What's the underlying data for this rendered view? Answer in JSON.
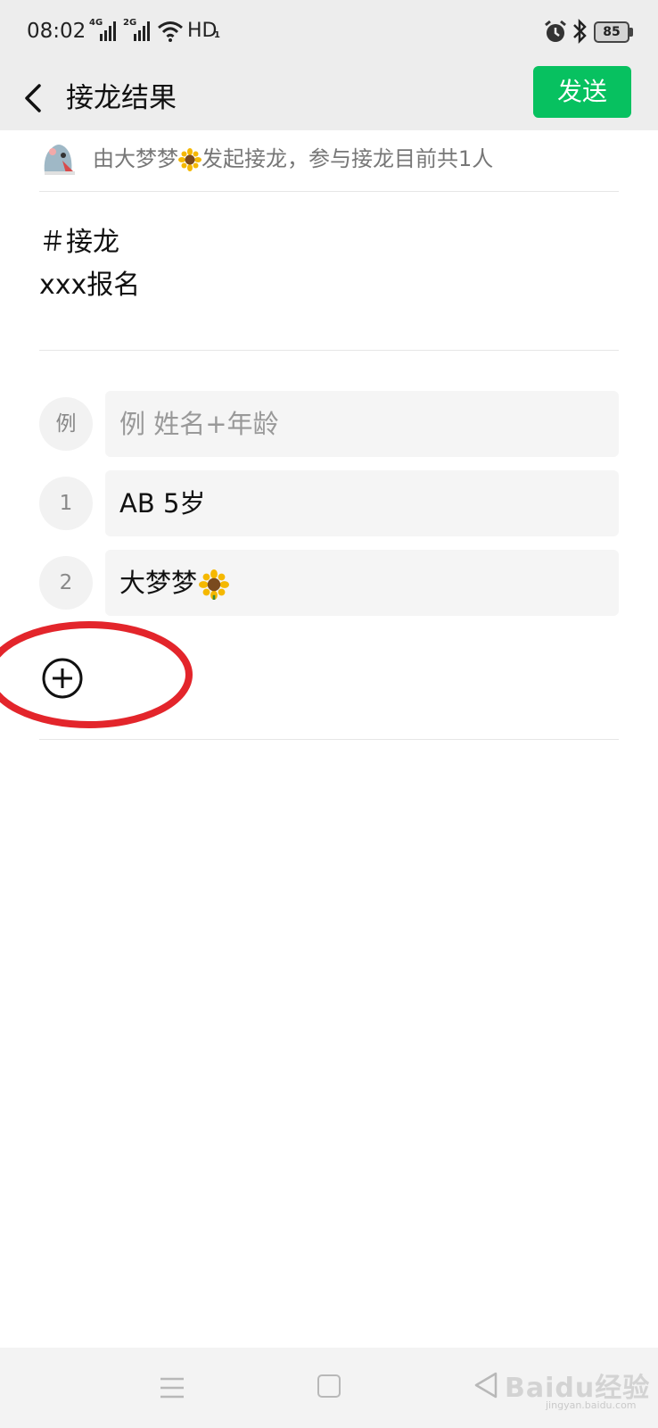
{
  "status_bar": {
    "time": "08:02",
    "signal1_label": "4G",
    "signal2_label": "2G",
    "network": "HD",
    "network_sub": "1",
    "battery": "85"
  },
  "nav": {
    "title": "接龙结果",
    "send_label": "发送"
  },
  "info": {
    "prefix": "由大梦梦",
    "suffix": "发起接龙，参与接龙目前共1人"
  },
  "description": {
    "line1": "＃接龙",
    "line2": "xxx报名"
  },
  "entries": [
    {
      "index": "例",
      "text": "例 姓名+年龄",
      "placeholder": true
    },
    {
      "index": "1",
      "text": "AB 5岁"
    },
    {
      "index": "2",
      "text": "大梦梦"
    }
  ],
  "watermark": {
    "text": "Baidu经验",
    "sub": "jingyan.baidu.com"
  },
  "colors": {
    "accent": "#07c160",
    "header_bg": "#ededed",
    "annotation": "#e3252b"
  },
  "icons": [
    "back-chevron-icon",
    "add-circle-icon",
    "sunflower-emoji-icon",
    "avatar-icon"
  ]
}
